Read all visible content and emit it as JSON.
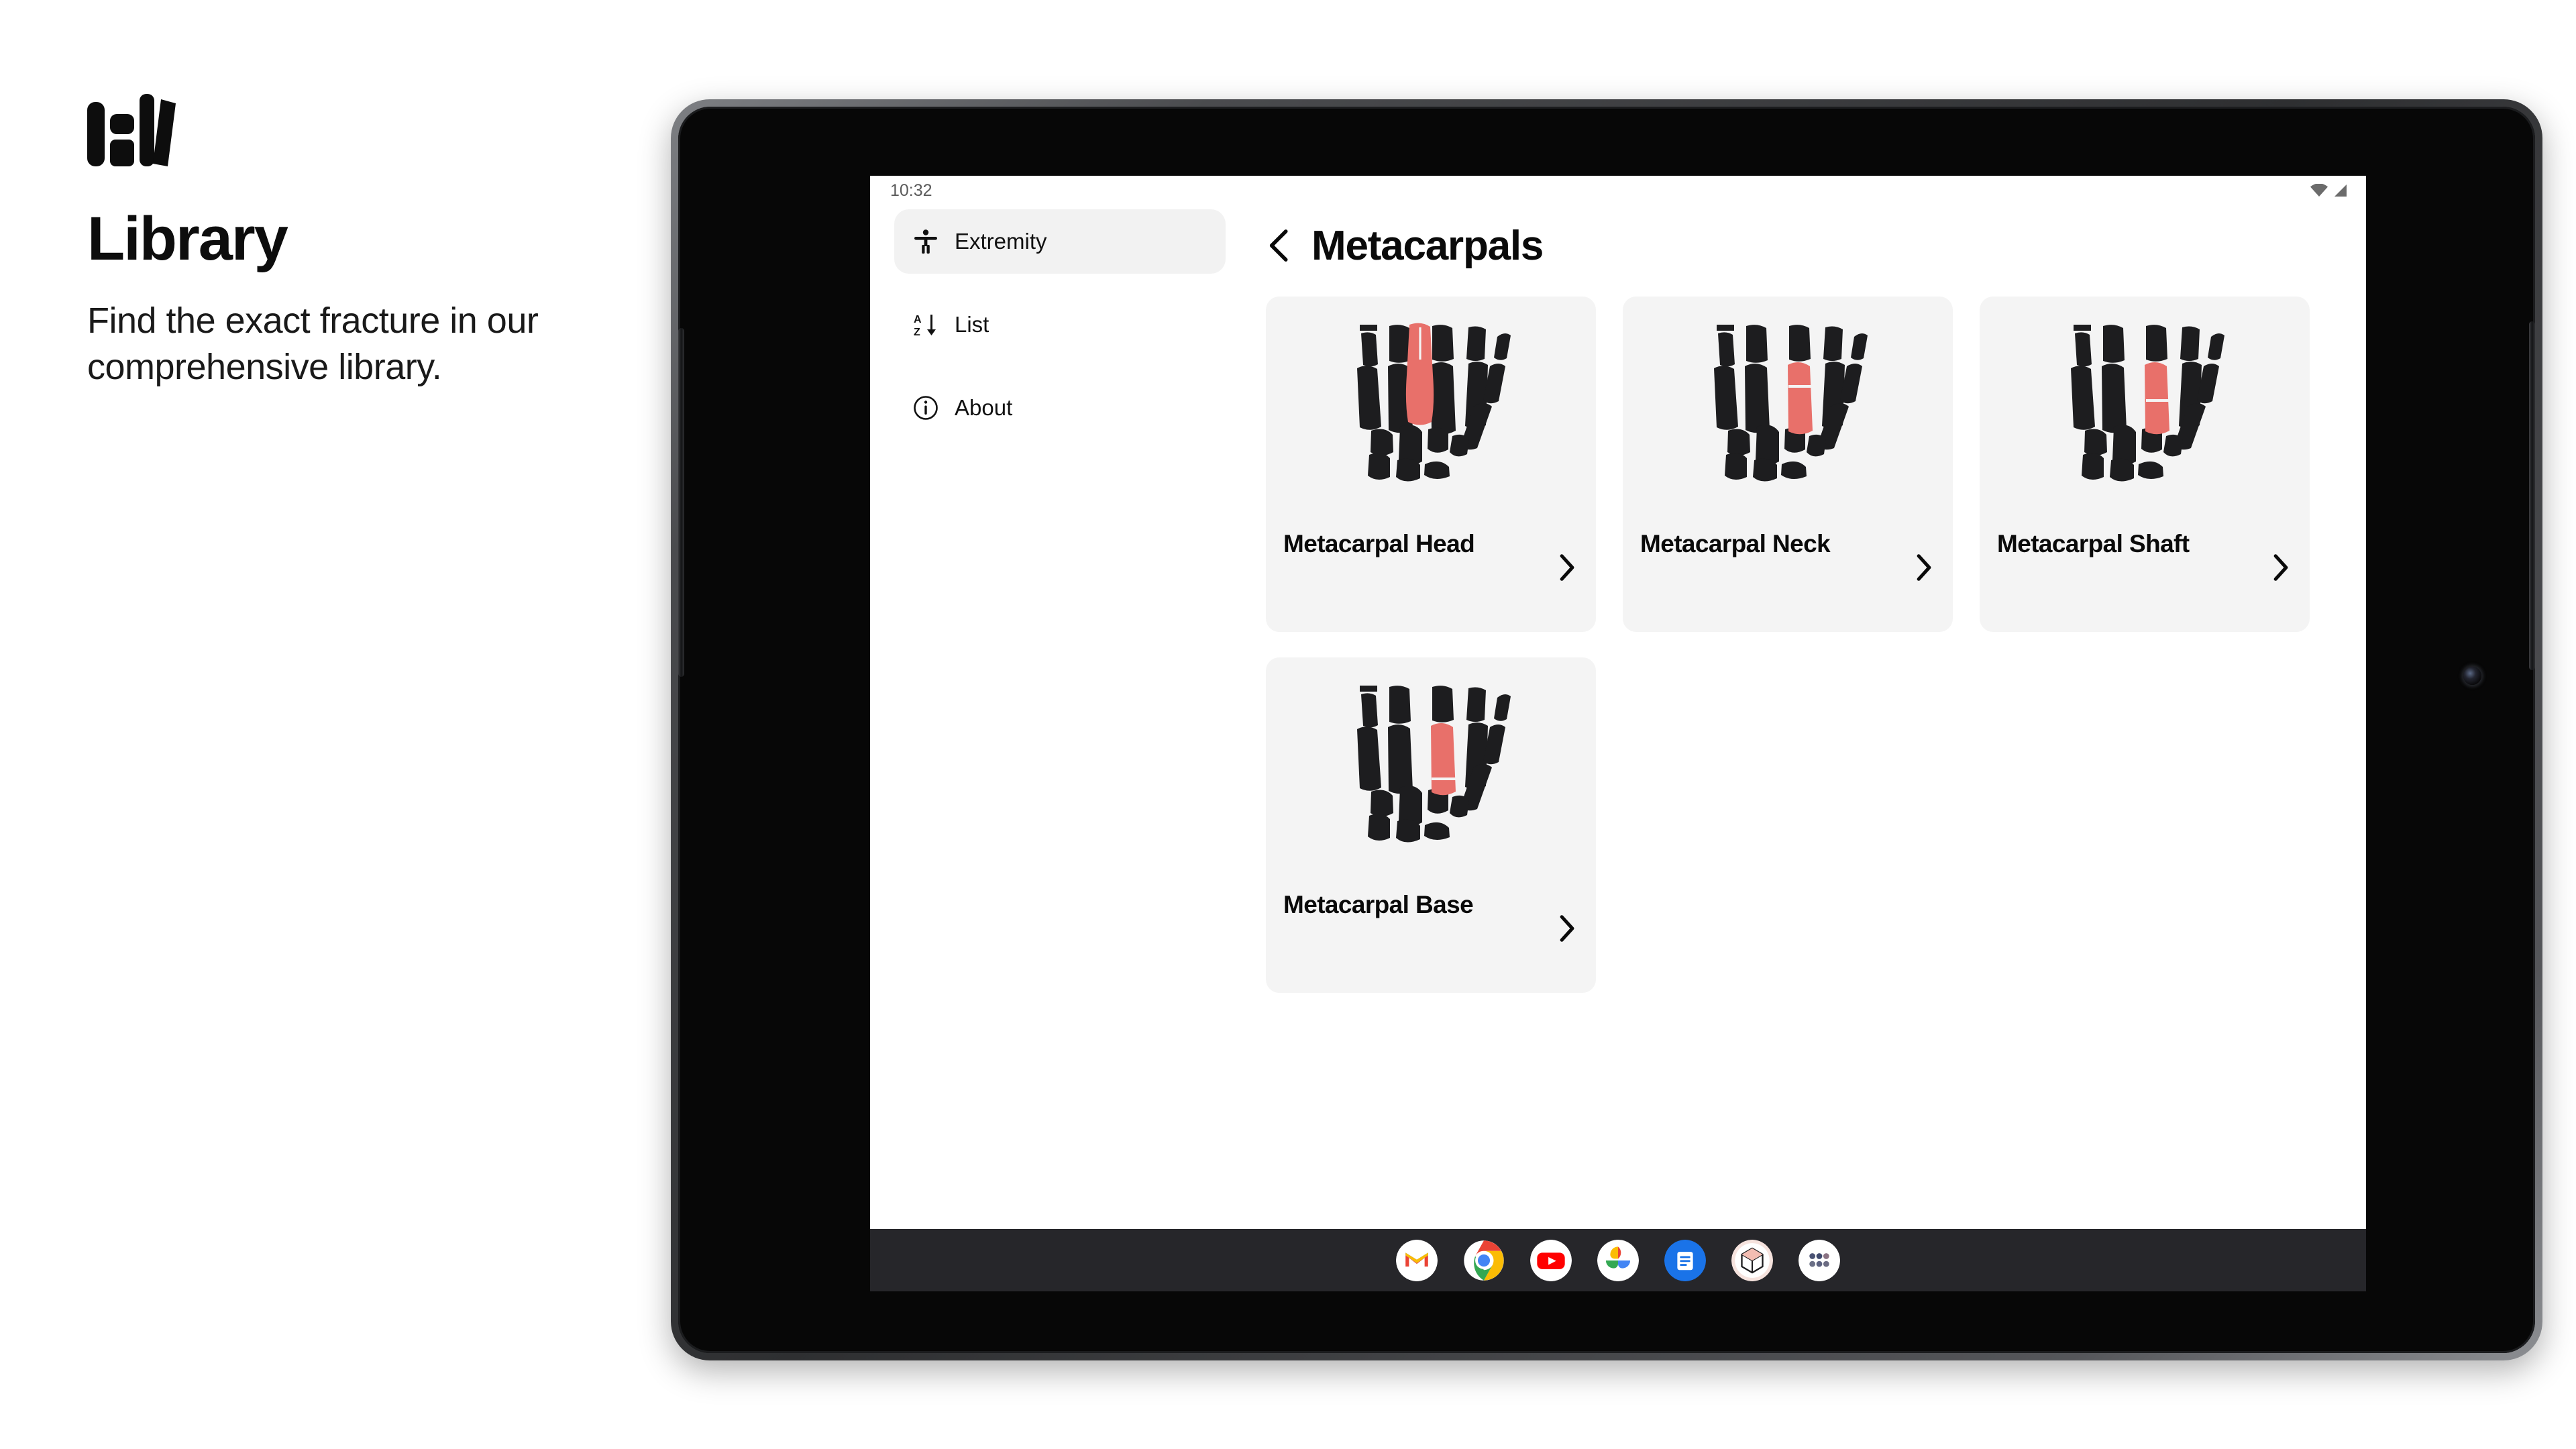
{
  "promo": {
    "logo_icon": "books-logo",
    "title": "Library",
    "subtitle": "Find the exact fracture in our comprehensive library."
  },
  "device": {
    "type": "android-tablet",
    "camera_icon": "front-camera",
    "left_button_icon": "volume-button",
    "right_button_icon": "power-button"
  },
  "statusbar": {
    "time": "10:32",
    "icons": [
      "wifi-icon",
      "cell-signal-icon"
    ]
  },
  "sidebar": {
    "items": [
      {
        "label": "Extremity",
        "icon": "accessibility-person-icon",
        "active": true
      },
      {
        "label": "List",
        "icon": "sort-az-icon",
        "active": false
      },
      {
        "label": "About",
        "icon": "info-circle-icon",
        "active": false
      }
    ]
  },
  "header": {
    "back_icon": "chevron-left-icon",
    "title": "Metacarpals"
  },
  "cards": [
    {
      "label": "Metacarpal Head",
      "chevron_icon": "chevron-right-icon",
      "art": "hand-skeleton-with-highlighted-metacarpal",
      "highlight_color": "#e8706a",
      "fracture_region": "head",
      "fracture_style": "vertical-split-top"
    },
    {
      "label": "Metacarpal Neck",
      "chevron_icon": "chevron-right-icon",
      "art": "hand-skeleton-with-highlighted-metacarpal",
      "highlight_color": "#e8706a",
      "fracture_region": "neck",
      "fracture_style": "horizontal-line-upper"
    },
    {
      "label": "Metacarpal Shaft",
      "chevron_icon": "chevron-right-icon",
      "art": "hand-skeleton-with-highlighted-metacarpal",
      "highlight_color": "#e8706a",
      "fracture_region": "shaft",
      "fracture_style": "horizontal-line-middle"
    },
    {
      "label": "Metacarpal Base",
      "chevron_icon": "chevron-right-icon",
      "art": "hand-skeleton-with-highlighted-metacarpal",
      "highlight_color": "#e8706a",
      "fracture_region": "base",
      "fracture_style": "horizontal-line-lower"
    }
  ],
  "taskbar": {
    "apps": [
      {
        "name": "gmail-icon"
      },
      {
        "name": "chrome-icon"
      },
      {
        "name": "youtube-icon"
      },
      {
        "name": "google-photos-icon"
      },
      {
        "name": "google-docs-icon"
      },
      {
        "name": "box-3d-icon"
      },
      {
        "name": "app-drawer-icon"
      }
    ]
  },
  "colors": {
    "bone": "#1d1d1f",
    "highlight": "#e8706a",
    "card_bg": "#f4f4f4",
    "nav_active_bg": "#f2f2f2",
    "taskbar_bg": "#26262a"
  }
}
